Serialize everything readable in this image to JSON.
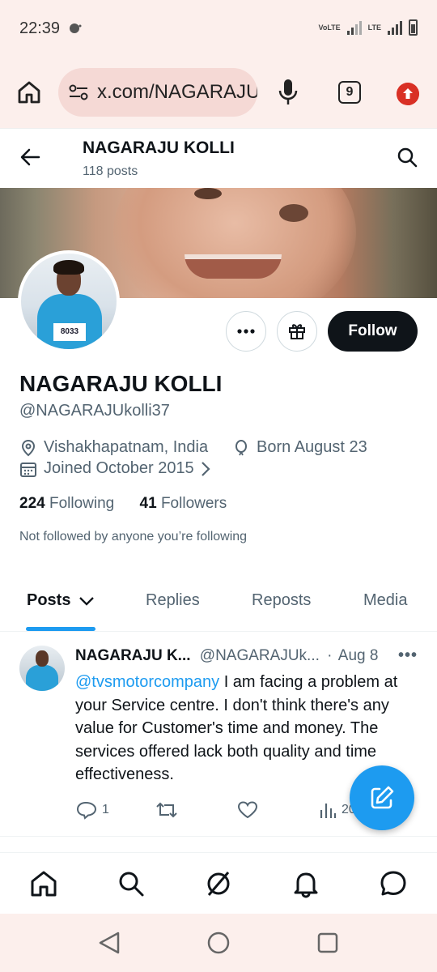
{
  "status_bar": {
    "time": "22:39",
    "network_label": "VoLTE",
    "lte_label": "LTE"
  },
  "browser": {
    "url": "x.com/NAGARAJU",
    "tab_count": "9"
  },
  "header": {
    "name": "NAGARAJU KOLLI",
    "post_count": "118 posts"
  },
  "profile": {
    "avatar_bib": "8033",
    "name": "NAGARAJU KOLLI",
    "handle": "@NAGARAJUkolli37",
    "location": "Vishakhapatnam, India",
    "birthday": "Born August 23",
    "joined": "Joined October 2015",
    "following_count": "224",
    "following_label": "Following",
    "followers_count": "41",
    "followers_label": "Followers",
    "not_followed_text": "Not followed by anyone you’re following",
    "follow_label": "Follow"
  },
  "tabs": [
    {
      "label": "Posts"
    },
    {
      "label": "Replies"
    },
    {
      "label": "Reposts"
    },
    {
      "label": "Media"
    }
  ],
  "tweet": {
    "author_name": "NAGARAJU K...",
    "author_handle": "@NAGARAJUk...",
    "separator": "·",
    "date": "Aug 8",
    "mention": "@tvsmotorcompany",
    "text": " I am facing a problem at your Service centre. I don't think there's any value for Customer's time and money. The services offered lack both quality and time effectiveness.",
    "reply_count": "1",
    "view_count": "20"
  },
  "colors": {
    "accent": "#1d9bf0",
    "text_primary": "#0f1419",
    "text_secondary": "#536471",
    "chrome": "#fcefec"
  }
}
